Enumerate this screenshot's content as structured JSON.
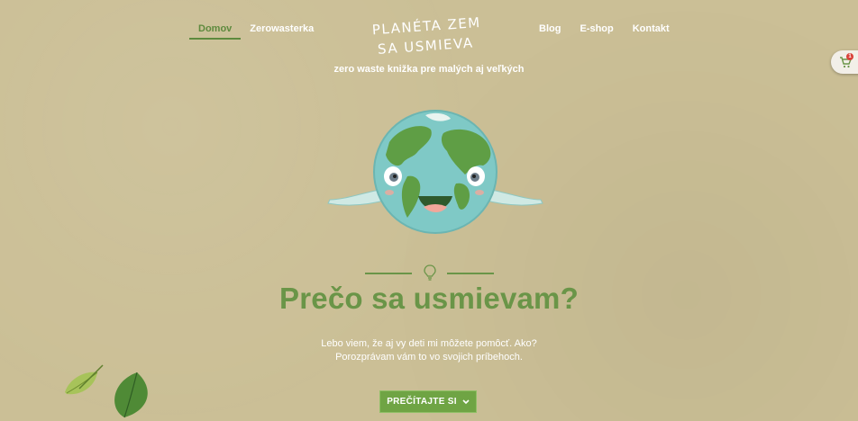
{
  "nav": {
    "left": [
      {
        "label": "Domov",
        "active": true
      },
      {
        "label": "Zerowasterka",
        "active": false
      }
    ],
    "right": [
      {
        "label": "Blog"
      },
      {
        "label": "E-shop"
      },
      {
        "label": "Kontakt"
      }
    ]
  },
  "logo": {
    "line1": "PLANÉTA ZEM",
    "line2": "SA USMIEVA"
  },
  "tagline": "zero waste knižka pre malých aj veľkých",
  "cart": {
    "icon": "shopping-cart-icon",
    "count": "1"
  },
  "hero": {
    "illustration": "smiling-earth-icon",
    "divider_icon": "lightbulb-icon",
    "title": "Prečo sa usmievam?",
    "text_line1": "Lebo viem, že aj vy deti mi môžete pomôcť. Ako?",
    "text_line2": "Porozprávam vám to vo svojich príbehoch.",
    "cta_label": "PREČÍTAJTE SI",
    "cta_icon": "chevron-down-icon"
  },
  "colors": {
    "background": "#cbbf96",
    "accent_green": "#6a9548",
    "button_green": "#6fa444",
    "text_white": "#ffffff"
  }
}
